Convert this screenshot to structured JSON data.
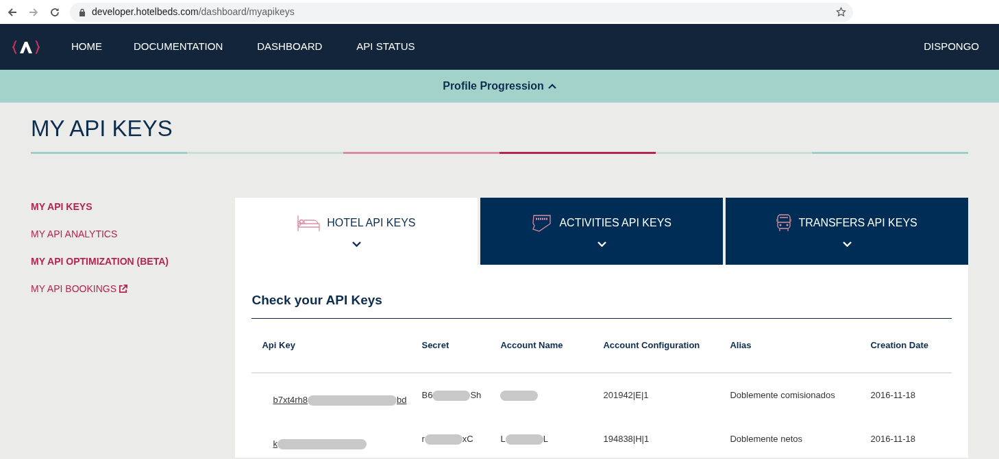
{
  "browser": {
    "url_host": "developer.hotelbeds.com",
    "url_path": "/dashboard/myapikeys"
  },
  "nav": {
    "items": [
      {
        "label": "HOME"
      },
      {
        "label": "DOCUMENTATION"
      },
      {
        "label": "DASHBOARD"
      },
      {
        "label": "API STATUS"
      }
    ],
    "user": "DISPONGO"
  },
  "profile_bar": {
    "label": "Profile Progression",
    "expanded": true
  },
  "page_title": "MY API KEYS",
  "progress_segments": [
    {
      "color": "#9ccfc8"
    },
    {
      "color": "#c9ddd6"
    },
    {
      "color": "#d98da3"
    },
    {
      "color": "#b5264f"
    },
    {
      "color": "#c9ddd6"
    },
    {
      "color": "#9ccfc8"
    }
  ],
  "sidebar": {
    "items": [
      {
        "label": "MY API KEYS",
        "selected": true,
        "external": false
      },
      {
        "label": "MY API ANALYTICS",
        "selected": false,
        "external": false
      },
      {
        "label": "MY API OPTIMIZATION (BETA)",
        "selected": true,
        "external": false
      },
      {
        "label": "MY API BOOKINGS",
        "selected": false,
        "external": true
      }
    ]
  },
  "tabs": [
    {
      "kind": "hotel",
      "label": "HOTEL API KEYS",
      "selected": true
    },
    {
      "kind": "ticket",
      "label": "ACTIVITIES API KEYS",
      "selected": false
    },
    {
      "kind": "bus",
      "label": "TRANSFERS API KEYS",
      "selected": false
    }
  ],
  "panel": {
    "title": "Check your API Keys",
    "table": {
      "columns": [
        "Api Key",
        "Secret",
        "Account Name",
        "Account Configuration",
        "Alias",
        "Creation Date"
      ],
      "rows": [
        {
          "api_key": {
            "start": "b7xt4rh8",
            "end": "bd"
          },
          "secret": {
            "start": "B6",
            "end": "Sh"
          },
          "account_name": {},
          "account_configuration": "201942|E|1",
          "alias": "Doblemente comisionados",
          "creation_date": "2016-11-18"
        },
        {
          "api_key": {
            "start": "k"
          },
          "secret": {
            "start": "r",
            "end": "xC"
          },
          "account_name": {
            "start": "L",
            "end": "L"
          },
          "account_configuration": "194838|H|1",
          "alias": "Doblemente netos",
          "creation_date": "2016-11-18"
        }
      ]
    }
  }
}
